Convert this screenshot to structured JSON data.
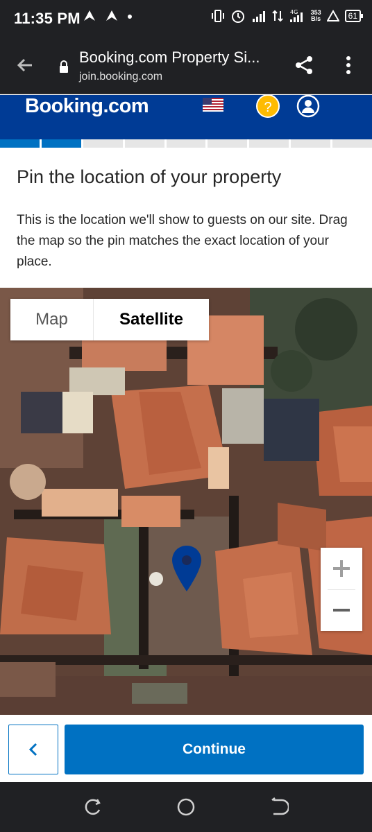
{
  "status_bar": {
    "time": "11:35 PM",
    "net_speed_top": "353",
    "net_speed_bottom": "B/s",
    "battery": "61",
    "icons": [
      "notification-icon",
      "notification-icon",
      "dot-icon",
      "vibrate-icon",
      "alarm-icon",
      "signal-icon",
      "data-arrows-icon",
      "4g-signal-icon",
      "warning-icon",
      "battery-icon"
    ]
  },
  "browser": {
    "title": "Booking.com Property Si...",
    "url": "join.booking.com"
  },
  "header": {
    "logo": "Booking.com",
    "help_label": "?",
    "colors": {
      "brand": "#003b95",
      "accent": "#0071c2",
      "help": "#febb02"
    }
  },
  "progress": {
    "completed_steps": 2,
    "total_steps": 9
  },
  "page": {
    "heading": "Pin the location of your property",
    "description": "This is the location we'll show to guests on our site. Drag the map so the pin matches the exact location of your place."
  },
  "map": {
    "type_options": [
      "Map",
      "Satellite"
    ],
    "selected_type": "Satellite"
  },
  "actions": {
    "continue_label": "Continue"
  }
}
